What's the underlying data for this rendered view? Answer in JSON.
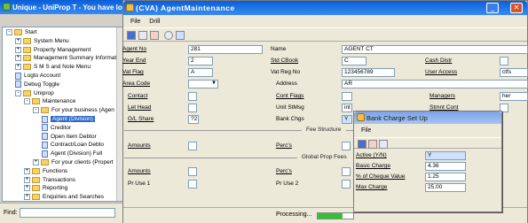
{
  "back_window": {
    "title": "Unique - UniProp T - You have logged",
    "find_label": "Find:",
    "tree": [
      {
        "label": "Start",
        "level": 0,
        "type": "folder",
        "exp": "-"
      },
      {
        "label": "System Menu",
        "level": 1,
        "type": "folder",
        "exp": "+"
      },
      {
        "label": "Property Management",
        "level": 1,
        "type": "folder",
        "exp": "+"
      },
      {
        "label": "Management Summary Informati",
        "level": 1,
        "type": "folder",
        "exp": "+"
      },
      {
        "label": "S M S and Note Menu",
        "level": 1,
        "type": "folder",
        "exp": "+"
      },
      {
        "label": "Logto Account",
        "level": 1,
        "type": "doc",
        "exp": ""
      },
      {
        "label": "Debug Toggle",
        "level": 1,
        "type": "doc",
        "exp": ""
      },
      {
        "label": "Uniprop",
        "level": 1,
        "type": "folder",
        "exp": "-"
      },
      {
        "label": "Maintenance",
        "level": 2,
        "type": "folder",
        "exp": "-"
      },
      {
        "label": "For your business (Agen",
        "level": 3,
        "type": "folder",
        "exp": "-"
      },
      {
        "label": "Agent (Division)",
        "level": 4,
        "type": "doc",
        "exp": "",
        "selected": true
      },
      {
        "label": "Creditor",
        "level": 4,
        "type": "doc",
        "exp": ""
      },
      {
        "label": "Open Item Debtor",
        "level": 4,
        "type": "doc",
        "exp": ""
      },
      {
        "label": "Contract/Loan Debto",
        "level": 4,
        "type": "doc",
        "exp": ""
      },
      {
        "label": "Agent (Division) Full",
        "level": 4,
        "type": "doc",
        "exp": ""
      },
      {
        "label": "For your clients (Propert",
        "level": 3,
        "type": "folder",
        "exp": "+"
      },
      {
        "label": "Functions",
        "level": 2,
        "type": "folder",
        "exp": "+"
      },
      {
        "label": "Transactions",
        "level": 2,
        "type": "folder",
        "exp": "+"
      },
      {
        "label": "Reporting",
        "level": 2,
        "type": "folder",
        "exp": "+"
      },
      {
        "label": "Enquiries and Searches",
        "level": 2,
        "type": "folder",
        "exp": "+"
      }
    ]
  },
  "main_window": {
    "title": "(CVA) AgentMaintenance",
    "menu": [
      "File",
      "Drill"
    ],
    "fields": {
      "agent_no": {
        "label": "Agent No",
        "value": "281"
      },
      "name": {
        "label": "Name",
        "value": "AGENT CT"
      },
      "year_end": {
        "label": "Year End",
        "value": "2"
      },
      "std_cbook": {
        "label": "Std CBook",
        "value": "C"
      },
      "cash_distr": {
        "label": "Cash Distr",
        "value": ""
      },
      "vat_flag": {
        "label": "Vat Flag",
        "value": "A"
      },
      "vat_reg_no": {
        "label": "Vat Reg No",
        "value": "123456789"
      },
      "user_access": {
        "label": "User Access",
        "value": "ctfs"
      },
      "area_code": {
        "label": "Area Code",
        "value": ""
      },
      "address": {
        "label": "Address",
        "value": "AR"
      },
      "contact": {
        "label": "Contact",
        "value": ""
      },
      "cont_flags": {
        "label": "Cont Flags",
        "value": ""
      },
      "managers": {
        "label": "Managers",
        "value": "her"
      },
      "let_head": {
        "label": "Let Head",
        "value": ""
      },
      "unit_stmsg": {
        "label": "Unit StMsg",
        "value": "int"
      },
      "stmnt_cont": {
        "label": "Stmnt Cont",
        "value": ""
      },
      "gl_share": {
        "label": "G/L Share",
        "value": "?2"
      },
      "bank_chgs": {
        "label": "Bank Chgs",
        "value": "Y"
      }
    },
    "sections": {
      "fee_structure": "Fee Structure",
      "global_prop_fees": "Global Prop Fees"
    },
    "amounts_label": "Amounts",
    "percs_label": "Perc's",
    "pr_use_1": "Pr Use 1",
    "pr_use_2": "Pr Use 2",
    "status_text": "Processing..."
  },
  "dialog": {
    "title": "Bank Charge Set Up",
    "menu": [
      "File"
    ],
    "fields": [
      {
        "label": "Active (Y/N)",
        "value": "Y"
      },
      {
        "label": "Basic Charge",
        "value": "4.36"
      },
      {
        "label": "% of Cheque Value",
        "value": "1.25"
      },
      {
        "label": "Max Charge",
        "value": "25.00"
      }
    ]
  },
  "colors": {
    "titlebar": "#0a5fd8",
    "selection": "#316ac5",
    "window_bg": "#ece9d8",
    "close_red": "#d9542b"
  }
}
